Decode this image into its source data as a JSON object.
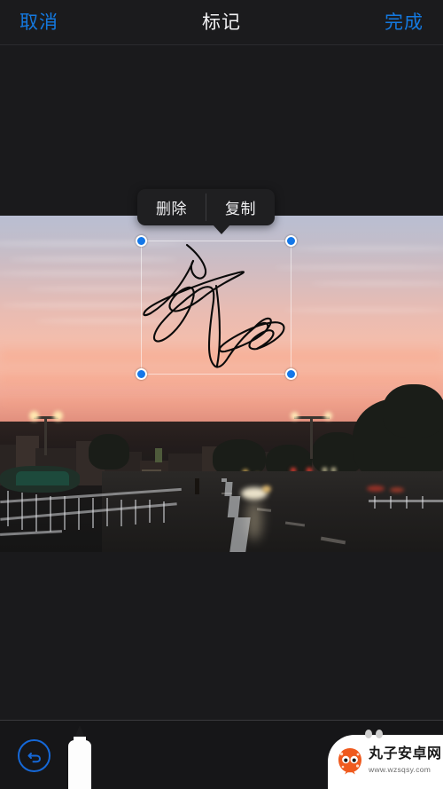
{
  "navbar": {
    "cancel_label": "取消",
    "title": "标记",
    "done_label": "完成",
    "accent_color": "#1479e0"
  },
  "context_menu": {
    "items": [
      {
        "label": "删除",
        "name": "delete"
      },
      {
        "label": "复制",
        "name": "copy"
      }
    ]
  },
  "canvas": {
    "photo_description": "城市日落街景照片",
    "annotation": {
      "type": "signature-scribble",
      "stroke_color": "#000000",
      "selected": true,
      "handle_color": "#1477e8",
      "handle_count": 4
    }
  },
  "toolbar": {
    "undo": {
      "name": "undo-button",
      "color": "#1568d8"
    },
    "pen": {
      "name": "pen-tool",
      "selected": true,
      "color": "#ffffff"
    },
    "colors": [
      {
        "name": "white",
        "hex": "#fbfbfb",
        "selected": false
      },
      {
        "name": "black",
        "hex": "#0a0a0a",
        "selected": true
      },
      {
        "name": "blue",
        "hex": "#1f78f0",
        "selected": false
      },
      {
        "name": "green",
        "hex": "#3fc45f",
        "selected": false
      },
      {
        "name": "yellow",
        "hex": "#f9c721",
        "selected": false
      },
      {
        "name": "red",
        "hex": "#f73b4c",
        "selected": false
      }
    ]
  },
  "watermark": {
    "title": "丸子安卓网",
    "url": "www.wzsqsy.com",
    "logo_color": "#ef5a1e"
  }
}
